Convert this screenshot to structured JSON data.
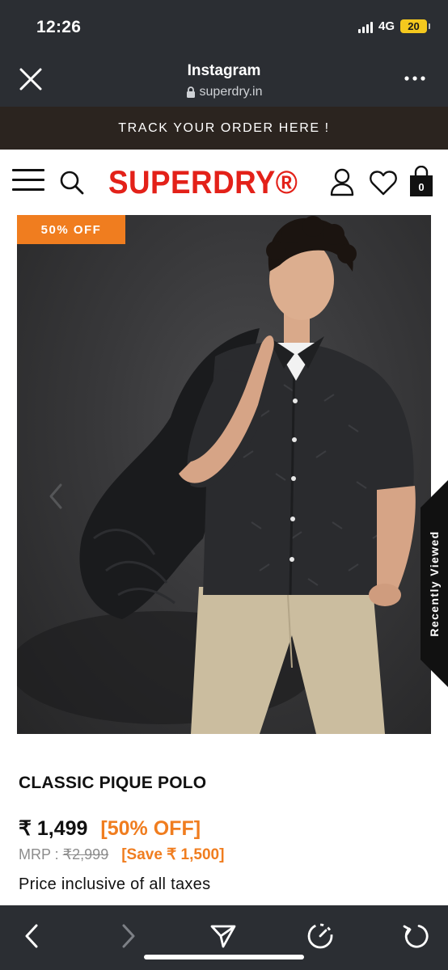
{
  "status_bar": {
    "time": "12:26",
    "network": "4G",
    "battery": "20"
  },
  "browser": {
    "title": "Instagram",
    "url": "superdry.in",
    "close_icon": "close-icon",
    "more_icon": "more-horizontal-icon"
  },
  "promo_banner": {
    "text": "TRACK YOUR ORDER HERE !"
  },
  "header": {
    "logo": "SUPERDRY®",
    "menu_icon": "hamburger-menu-icon",
    "search_icon": "search-icon",
    "account_icon": "user-icon",
    "wishlist_icon": "heart-icon",
    "bag_icon": "shopping-bag-icon",
    "bag_count": "0"
  },
  "product": {
    "badge": "50% OFF",
    "image_description": "Model wearing dark patterned shirt and beige chinos, holding a black puffer jacket",
    "name": "CLASSIC PIQUE POLO",
    "price": "₹ 1,499",
    "discount": "[50% OFF]",
    "mrp_label": "MRP :",
    "mrp_value": "₹2,999",
    "save": "[Save ₹ 1,500]",
    "tax_note": "Price inclusive of all taxes"
  },
  "recently_viewed": {
    "label": "Recently Viewed"
  },
  "toolbar": {
    "back_icon": "chevron-left-icon",
    "forward_icon": "chevron-right-icon",
    "share_icon": "send-icon",
    "timer_icon": "timer-icon",
    "reload_icon": "reload-icon"
  },
  "colors": {
    "brand_red": "#e32119",
    "accent_orange": "#f07d1f",
    "dark_bar": "#2b2e33",
    "promo_bg": "#2b241f"
  }
}
